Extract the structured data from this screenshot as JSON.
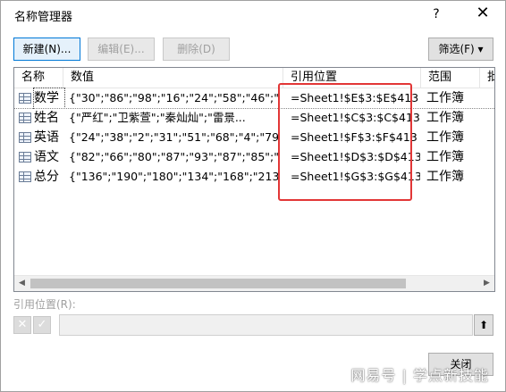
{
  "dialog": {
    "title": "名称管理器",
    "help_label": "?",
    "close_label": "✕"
  },
  "toolbar": {
    "new_label": "新建(N)...",
    "edit_label": "编辑(E)...",
    "delete_label": "删除(D)",
    "filter_label": "筛选(F) ▾"
  },
  "columns": [
    "名称",
    "数值",
    "引用位置",
    "范围",
    "批"
  ],
  "rows": [
    {
      "name": "数学",
      "value": "{\"30\";\"86\";\"98\";\"16\";\"24\";\"58\";\"46\";\"...",
      "ref": "=Sheet1!$E$3:$E$413",
      "scope": "工作簿"
    },
    {
      "name": "姓名",
      "value": "{\"严红\";\"卫紫萱\";\"秦灿灿\";\"雷景...",
      "ref": "=Sheet1!$C$3:$C$413",
      "scope": "工作簿"
    },
    {
      "name": "英语",
      "value": "{\"24\";\"38\";\"2\";\"31\";\"51\";\"68\";\"4\";\"79...",
      "ref": "=Sheet1!$F$3:$F$413",
      "scope": "工作簿"
    },
    {
      "name": "语文",
      "value": "{\"82\";\"66\";\"80\";\"87\";\"93\";\"87\";\"85\";\"...",
      "ref": "=Sheet1!$D$3:$D$413",
      "scope": "工作簿"
    },
    {
      "name": "总分",
      "value": "{\"136\";\"190\";\"180\";\"134\";\"168\";\"213...",
      "ref": "=Sheet1!$G$3:$G$413",
      "scope": "工作簿"
    }
  ],
  "ref_section": {
    "label": "引用位置(R):",
    "cancel_glyph": "✕",
    "confirm_glyph": "✓",
    "collapse_glyph": "⬆"
  },
  "footer": {
    "close_label": "关闭"
  },
  "watermark": "网易号 | 学点新技能",
  "colors": {
    "highlight": "#e23636",
    "default_button_border": "#0078d7"
  }
}
